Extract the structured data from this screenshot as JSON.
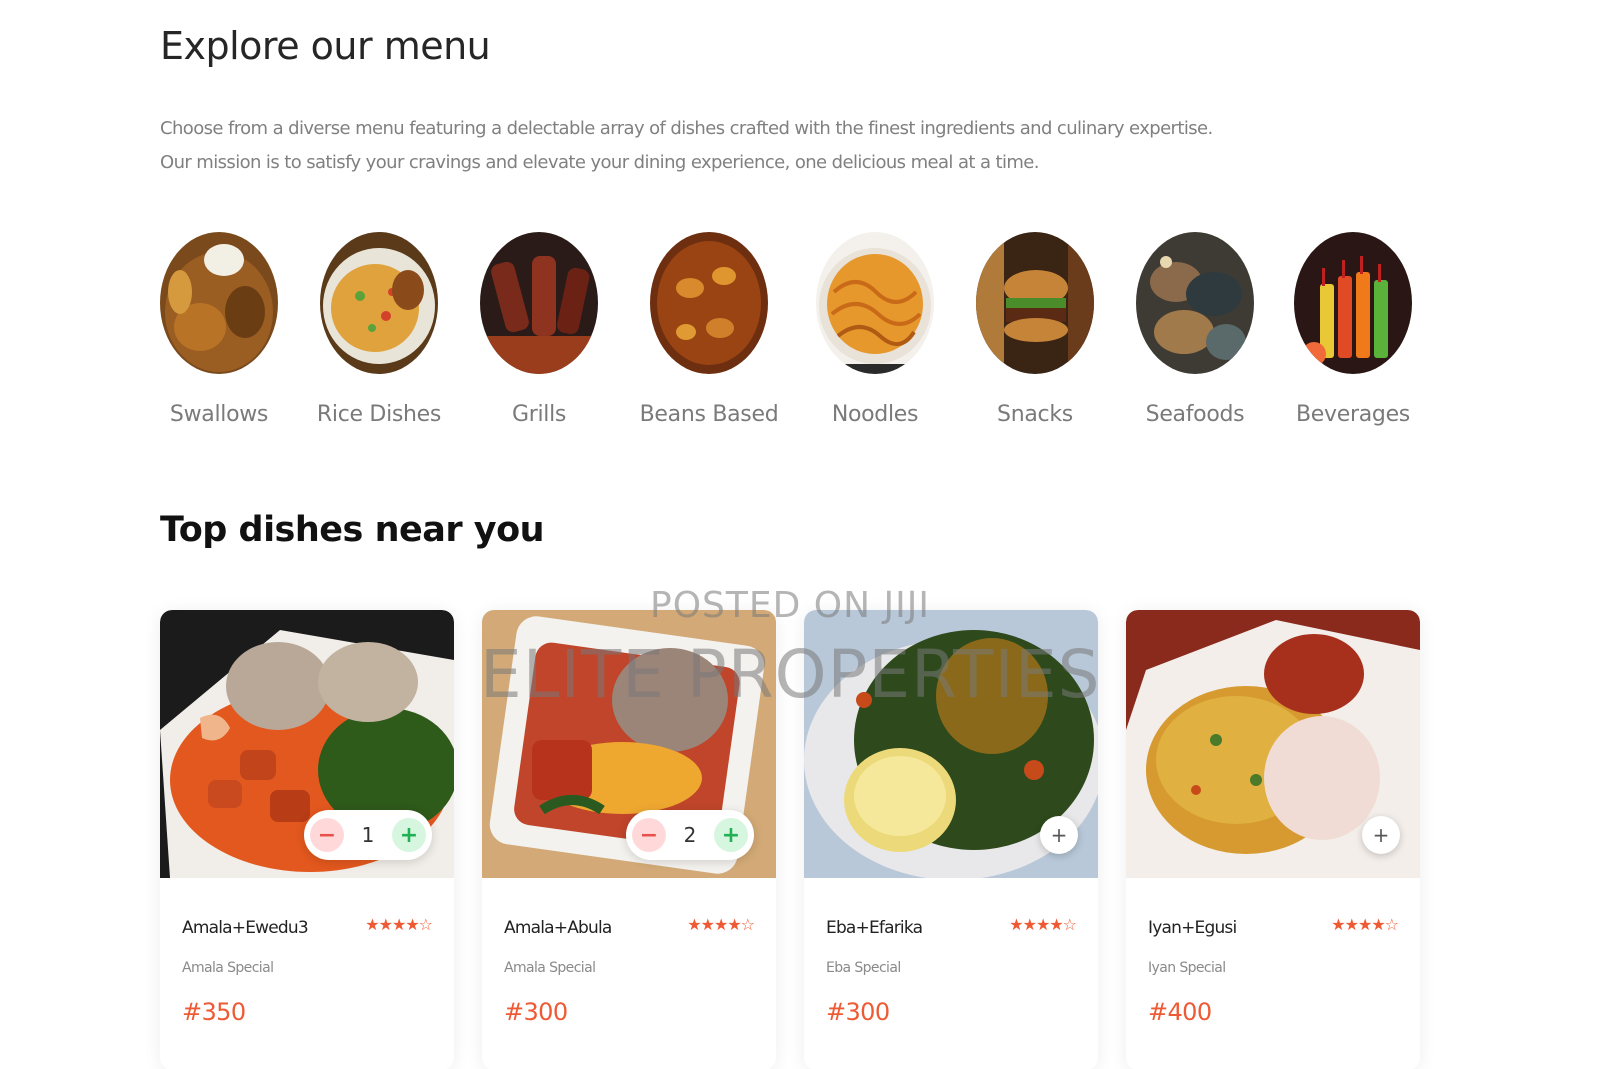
{
  "explore": {
    "title": "Explore our menu",
    "description": "Choose from a diverse menu featuring a delectable array of dishes crafted with the finest ingredients and culinary expertise. Our mission is to satisfy your cravings and elevate your dining experience, one delicious meal at a time."
  },
  "categories": [
    {
      "label": "Swallows"
    },
    {
      "label": "Rice Dishes"
    },
    {
      "label": "Grills"
    },
    {
      "label": "Beans Based"
    },
    {
      "label": "Noodles"
    },
    {
      "label": "Snacks"
    },
    {
      "label": "Seafoods"
    },
    {
      "label": "Beverages"
    }
  ],
  "top_dishes": {
    "title": "Top dishes near you",
    "items": [
      {
        "name": "Amala+Ewedu3",
        "subtitle": "Amala Special",
        "price": "#350",
        "stars": "★★★★☆",
        "rating": 4,
        "quantity": "1",
        "minus_glyph": "−",
        "plus_glyph": "+"
      },
      {
        "name": "Amala+Abula",
        "subtitle": "Amala Special",
        "price": "#300",
        "stars": "★★★★☆",
        "rating": 4,
        "quantity": "2",
        "minus_glyph": "−",
        "plus_glyph": "+"
      },
      {
        "name": "Eba+Efarika",
        "subtitle": "Eba Special",
        "price": "#300",
        "stars": "★★★★☆",
        "rating": 4,
        "add_glyph": "+"
      },
      {
        "name": "Iyan+Egusi",
        "subtitle": "Iyan Special",
        "price": "#400",
        "stars": "★★★★☆",
        "rating": 4,
        "add_glyph": "+"
      }
    ]
  },
  "watermark": {
    "line1": "POSTED ON JIJI",
    "line2": "ELITE PROPERTIES"
  },
  "colors": {
    "accent": "#ee5a34",
    "minus_bg": "#ffd9d9",
    "plus_bg": "#d6f6df",
    "text_muted": "#808080"
  }
}
